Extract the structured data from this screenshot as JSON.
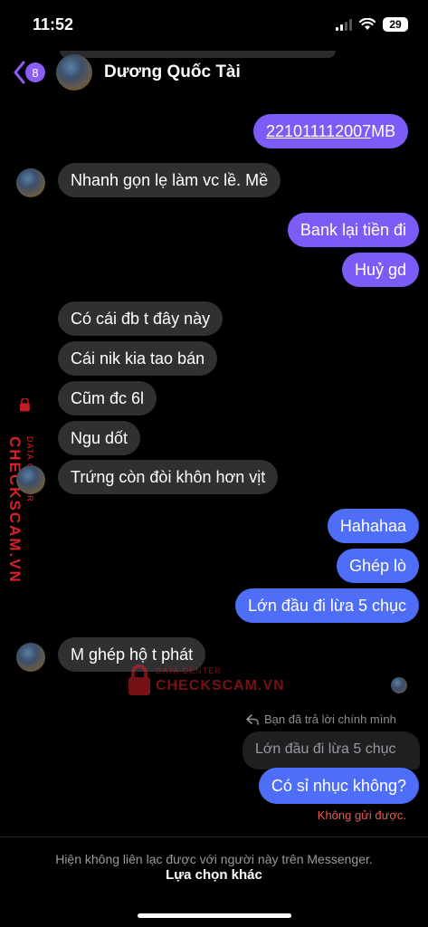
{
  "status": {
    "time": "11:52",
    "battery": "29"
  },
  "header": {
    "back_badge": "8",
    "contact_name": "Dương Quốc Tài"
  },
  "messages": [
    {
      "from": "me",
      "text": "221011112007",
      "suffix": " MB"
    },
    {
      "from": "them",
      "text": "Nhanh gọn lẹ làm vc lề. Mề"
    },
    {
      "from": "me",
      "text": "Bank lại tiền đi"
    },
    {
      "from": "me",
      "text": "Huỷ gd"
    },
    {
      "from": "them",
      "text": "Có cái đb t đây này"
    },
    {
      "from": "them",
      "text": "Cái nik kia tao bán"
    },
    {
      "from": "them",
      "text": "Cũm đc 6l"
    },
    {
      "from": "them",
      "text": "Ngu dốt"
    },
    {
      "from": "them",
      "text": "Trứng còn đòi khôn hơn vịt"
    },
    {
      "from": "me",
      "text": "Hahahaa"
    },
    {
      "from": "me",
      "text": "Ghép lò"
    },
    {
      "from": "me",
      "text": "Lớn đầu đi lừa 5 chục"
    },
    {
      "from": "them",
      "text": "M ghép hộ t phát"
    },
    {
      "from": "me",
      "text": "Có sỉ nhục không?"
    }
  ],
  "reply": {
    "label": "Bạn đã trả lời chính mình",
    "quoted_text": "Lớn đầu đi lừa 5 chục"
  },
  "error": "Không gửi được.",
  "footer": {
    "notice": "Hiện không liên lạc được với người này trên Messenger.",
    "link": "Lựa chọn khác"
  },
  "watermark": {
    "brand": "CHECKSCAM.VN",
    "sub": "DATA CENTER"
  },
  "colors": {
    "purple_bubble": "#7c5cf6",
    "blue_bubble": "#4f6ef7",
    "incoming_bubble": "#303033",
    "error": "#e85a55",
    "watermark": "#d8202a"
  }
}
